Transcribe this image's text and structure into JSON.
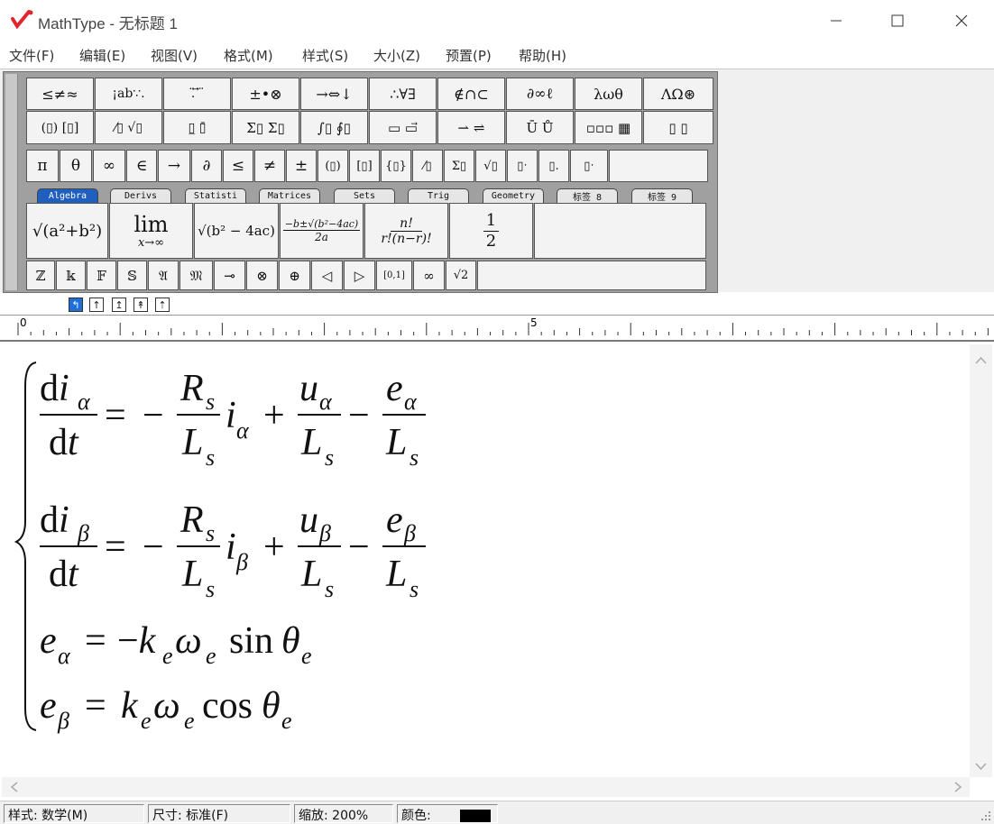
{
  "window": {
    "title": "MathType - 无标题 1"
  },
  "menu": [
    "文件(F)",
    "编辑(E)",
    "视图(V)",
    "格式(M)",
    "样式(S)",
    "大小(Z)",
    "预置(P)",
    "帮助(H)"
  ],
  "symbol_row1": [
    "≤≠≈",
    "¡ab∵.",
    "⁚̈ ⃗ ⃛",
    "±•⊗",
    "→⇔↓",
    "∴∀∃",
    "∉∩⊂",
    "∂∞ℓ",
    "λωθ",
    "ΛΩ⊛"
  ],
  "symbol_row2": [
    "(▯) [▯]",
    "⁄▯ √▯",
    "▯̲ ▯̄",
    "Σ▯ Σ▯",
    "∫▯ ∮▯",
    "▭ ▭⃗",
    "⇀ ⇌",
    "Ū Ů",
    "▫▫▫ ▦",
    "▯ ▯"
  ],
  "small_bar": [
    "π",
    "θ",
    "∞",
    "∈",
    "→",
    "∂",
    "≤",
    "≠",
    "±",
    "(▯)",
    "[▯]",
    "{▯}",
    "⁄▯",
    "Σ▯",
    "√▯",
    "▯ˑ",
    "▯.",
    "▯ˑ"
  ],
  "tabs": [
    "Algebra",
    "Derivs",
    "Statisti",
    "Matrices",
    "Sets",
    "Trig",
    "Geometry",
    "标签 8",
    "标签 9"
  ],
  "templates": {
    "t1": "√(a²+b²)",
    "t2_top": "lim",
    "t2_bottom": "x→∞",
    "t3": "√(b² − 4ac)",
    "t4_num": "−b±√(b²−4ac)",
    "t4_den": "2a",
    "t5_num": "n!",
    "t5_den": "r!(n−r)!",
    "t6_num": "1",
    "t6_den": "2"
  },
  "bottom_bar": [
    "ℤ",
    "𝕜",
    "𝔽",
    "𝕊",
    "𝔄",
    "𝔐",
    "⊸",
    "⊗",
    "⊕",
    "◁",
    "▷",
    "[0,1]",
    "∞",
    "√2"
  ],
  "ruler": {
    "mark0": "0",
    "mark5": "5"
  },
  "status": {
    "style": "样式: 数学(M)",
    "size": "尺寸: 标准(F)",
    "zoom": "缩放: 200%",
    "color_label": "颜色:"
  }
}
